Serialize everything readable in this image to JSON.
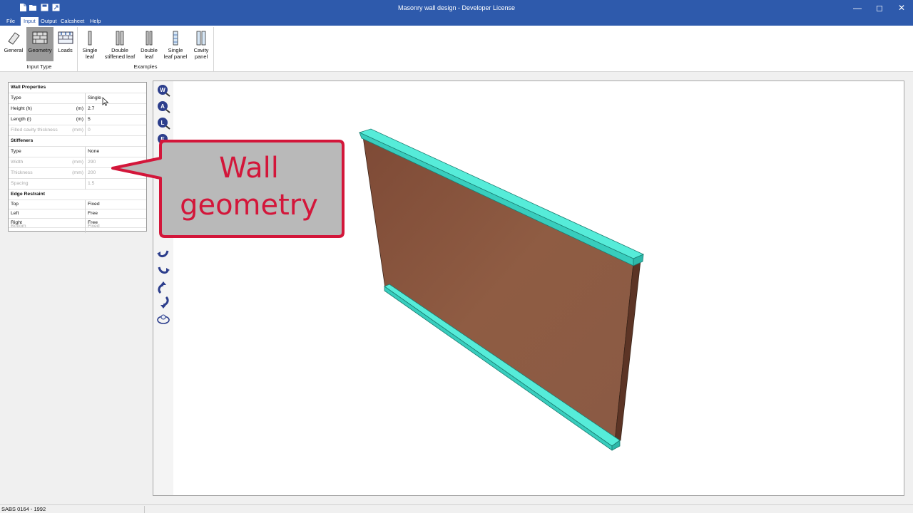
{
  "window": {
    "title": "Masonry wall design - Developer License",
    "controls": [
      "minimize-icon",
      "maximize-icon",
      "close-icon"
    ]
  },
  "quick_access": [
    "new-file-icon",
    "open-folder-icon",
    "save-icon",
    "export-icon"
  ],
  "menu": {
    "tabs": [
      {
        "label": "File",
        "active": false
      },
      {
        "label": "Input",
        "active": true
      },
      {
        "label": "Output",
        "active": false
      },
      {
        "label": "Calcsheet",
        "active": false
      },
      {
        "label": "Help",
        "active": false
      }
    ]
  },
  "ribbon": {
    "input_type": {
      "label": "Input Type",
      "buttons": [
        {
          "label": "General",
          "icon": "eraser-icon",
          "selected": false
        },
        {
          "label": "Geometry",
          "icon": "wall-geometry-icon",
          "selected": true
        },
        {
          "label": "Loads",
          "icon": "loads-icon",
          "selected": false
        }
      ]
    },
    "examples": {
      "label": "Examples",
      "buttons": [
        {
          "label1": "Single",
          "label2": "leaf",
          "icon": "single-leaf-icon"
        },
        {
          "label1": "Double",
          "label2": "stiffened leaf",
          "icon": "double-stiffened-leaf-icon"
        },
        {
          "label1": "Double",
          "label2": "leaf",
          "icon": "double-leaf-icon"
        },
        {
          "label1": "Single",
          "label2": "leaf panel",
          "icon": "single-leaf-panel-icon"
        },
        {
          "label1": "Cavity",
          "label2": "panel",
          "icon": "cavity-panel-icon"
        }
      ]
    }
  },
  "properties": {
    "wall_header": "Wall Properties",
    "wall": [
      {
        "key": "Type",
        "unit": "",
        "value": "Single",
        "enabled": true
      },
      {
        "key": "Height (h)",
        "unit": "(m)",
        "value": "2.7",
        "enabled": true
      },
      {
        "key": "Length (l)",
        "unit": "(m)",
        "value": "5",
        "enabled": true
      },
      {
        "key": "Filled cavity thickness",
        "unit": "(mm)",
        "value": "0",
        "enabled": false
      }
    ],
    "stiffeners_header": "Stiffeners",
    "stiffeners": [
      {
        "key": "Type",
        "unit": "",
        "value": "None",
        "enabled": true
      },
      {
        "key": "Width",
        "unit": "(mm)",
        "value": "290",
        "enabled": false
      },
      {
        "key": "Thickness",
        "unit": "(mm)",
        "value": "200",
        "enabled": false
      },
      {
        "key": "Spacing",
        "unit": "",
        "value": "1.5",
        "enabled": false
      }
    ],
    "edge_header": "Edge Restraint",
    "edge": [
      {
        "key": "Top",
        "unit": "",
        "value": "Fixed",
        "enabled": true
      },
      {
        "key": "Left",
        "unit": "",
        "value": "Free",
        "enabled": true
      },
      {
        "key": "Right",
        "unit": "",
        "value": "Free",
        "enabled": true
      },
      {
        "key": "Bottom",
        "unit": "",
        "value": "Fixed",
        "enabled": false
      }
    ]
  },
  "view_tools": [
    "view-w-icon",
    "view-a-icon",
    "view-l-icon",
    "view-e-icon",
    "rotate-left-icon",
    "rotate-right-icon",
    "rotate-up-icon",
    "rotate-down-icon",
    "orbit-icon"
  ],
  "callout": {
    "line1": "Wall",
    "line2": "geometry"
  },
  "colors": {
    "title_bar": "#2e5aac",
    "wall_face": "#8e5a42",
    "wall_beam": "#4ee0cf",
    "callout_border": "#d3163a",
    "callout_fill": "#b9b9b9"
  },
  "status": {
    "standard": "SABS 0164 - 1992"
  }
}
